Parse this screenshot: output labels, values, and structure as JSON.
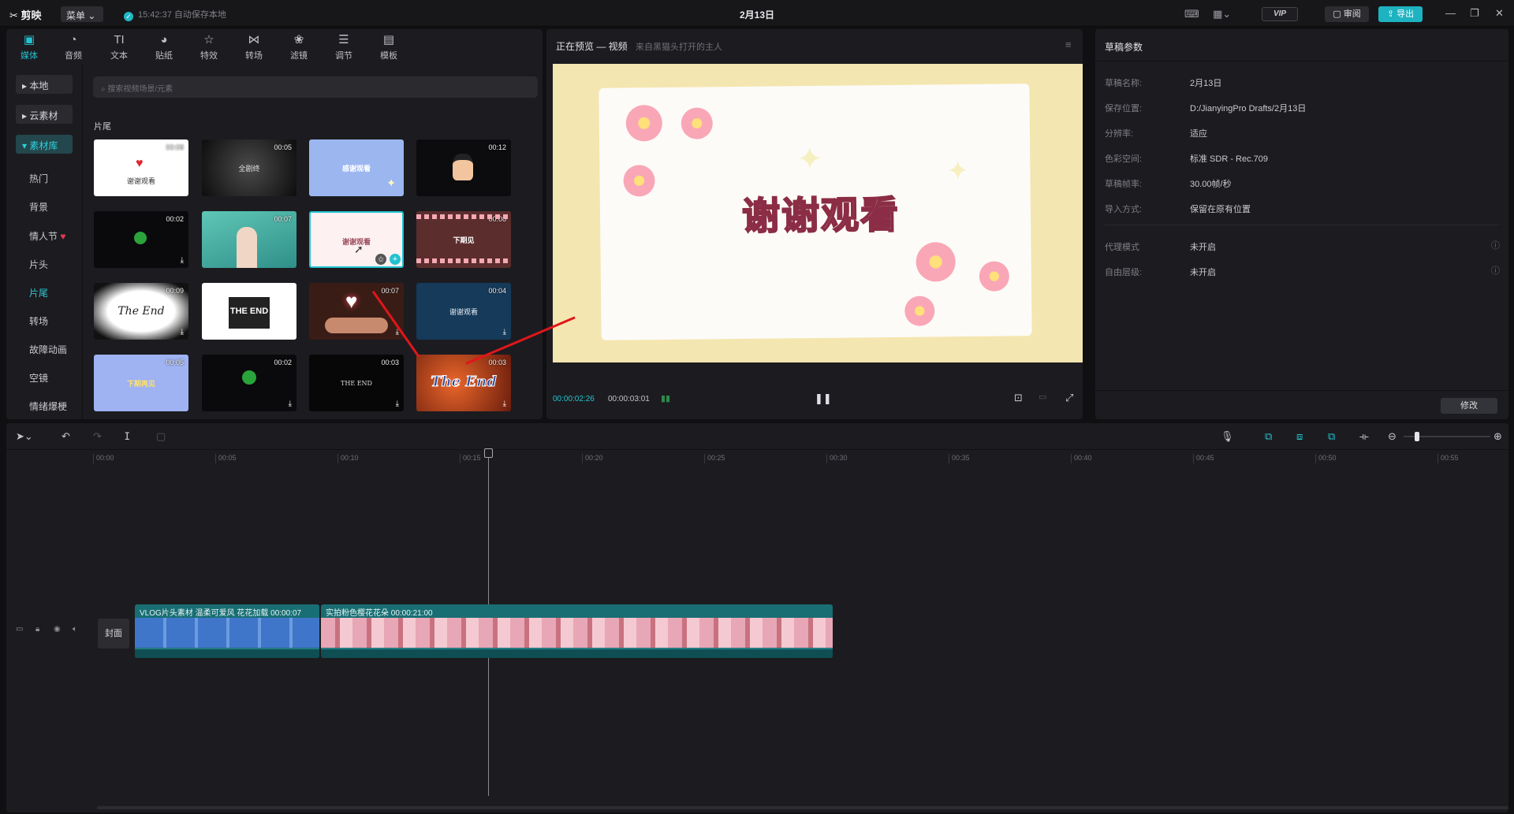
{
  "topbar": {
    "app_name": "剪映",
    "menu_label": "菜单",
    "save_status": "15:42:37 自动保存本地",
    "doc_title": "2月13日",
    "vip": "VIP",
    "review": "审阅",
    "export": "导出"
  },
  "tool_tabs": [
    {
      "label": "媒体",
      "icon": "▣"
    },
    {
      "label": "音频",
      "icon": "◔"
    },
    {
      "label": "文本",
      "icon": "TI"
    },
    {
      "label": "贴纸",
      "icon": "◕"
    },
    {
      "label": "特效",
      "icon": "☆"
    },
    {
      "label": "转场",
      "icon": "⋈"
    },
    {
      "label": "滤镜",
      "icon": "❀"
    },
    {
      "label": "调节",
      "icon": "☰"
    },
    {
      "label": "模板",
      "icon": "▤"
    }
  ],
  "side_nav": {
    "local": "本地",
    "cloud": "云素材",
    "library": "素材库",
    "items": [
      "热门",
      "背景",
      "情人节",
      "片头",
      "片尾",
      "转场",
      "故障动画",
      "空镜",
      "情绪爆梗"
    ]
  },
  "search_placeholder": "搜索视频场景/元素",
  "section_title": "片尾",
  "thumbs": [
    {
      "dur": "00:08",
      "text": "谢谢观看"
    },
    {
      "dur": "00:05",
      "text": "全剧终"
    },
    {
      "dur": "",
      "text": "感谢观看"
    },
    {
      "dur": "00:12",
      "text": ""
    },
    {
      "dur": "00:02",
      "text": ""
    },
    {
      "dur": "00:07",
      "text": ""
    },
    {
      "dur": "",
      "text": "谢谢观看"
    },
    {
      "dur": "00:08",
      "text": "下期见"
    },
    {
      "dur": "00:09",
      "text": "The End"
    },
    {
      "dur": "",
      "text": "THE END"
    },
    {
      "dur": "00:07",
      "text": ""
    },
    {
      "dur": "00:04",
      "text": "谢谢观看"
    },
    {
      "dur": "00:05",
      "text": "下期再见"
    },
    {
      "dur": "00:02",
      "text": ""
    },
    {
      "dur": "00:03",
      "text": "THE END"
    },
    {
      "dur": "00:03",
      "text": "The End"
    }
  ],
  "preview": {
    "title": "正在预览 — 视频",
    "subtitle": "来自黑猫头打开的主人",
    "card_text": "谢谢观看",
    "current_time": "00:00:02:26",
    "total_time": "00:00:03:01"
  },
  "draft": {
    "title": "草稿参数",
    "props": [
      {
        "k": "草稿名称:",
        "v": "2月13日"
      },
      {
        "k": "保存位置:",
        "v": "D:/JianyingPro Drafts/2月13日"
      },
      {
        "k": "分辨率:",
        "v": "适应"
      },
      {
        "k": "色彩空间:",
        "v": "标准 SDR - Rec.709"
      },
      {
        "k": "草稿帧率:",
        "v": "30.00帧/秒"
      },
      {
        "k": "导入方式:",
        "v": "保留在原有位置"
      },
      {
        "k": "代理模式",
        "v": "未开启"
      },
      {
        "k": "自由层级:",
        "v": "未开启"
      }
    ],
    "modify": "修改"
  },
  "timeline": {
    "ticks": [
      "00:00",
      "00:05",
      "00:10",
      "00:15",
      "00:20",
      "00:25",
      "00:30",
      "00:35",
      "00:40",
      "00:45",
      "00:50",
      "00:55"
    ],
    "cover": "封面",
    "clip1_label": "VLOG片头素材 温柔可爱风 花花加载",
    "clip1_dur": "00:00:07",
    "clip2_label": "实拍粉色樱花花朵",
    "clip2_dur": "00:00:21:00"
  },
  "colors": {
    "accent": "#22c3d0",
    "clip": "#186e73",
    "arrow": "#e0161a"
  }
}
